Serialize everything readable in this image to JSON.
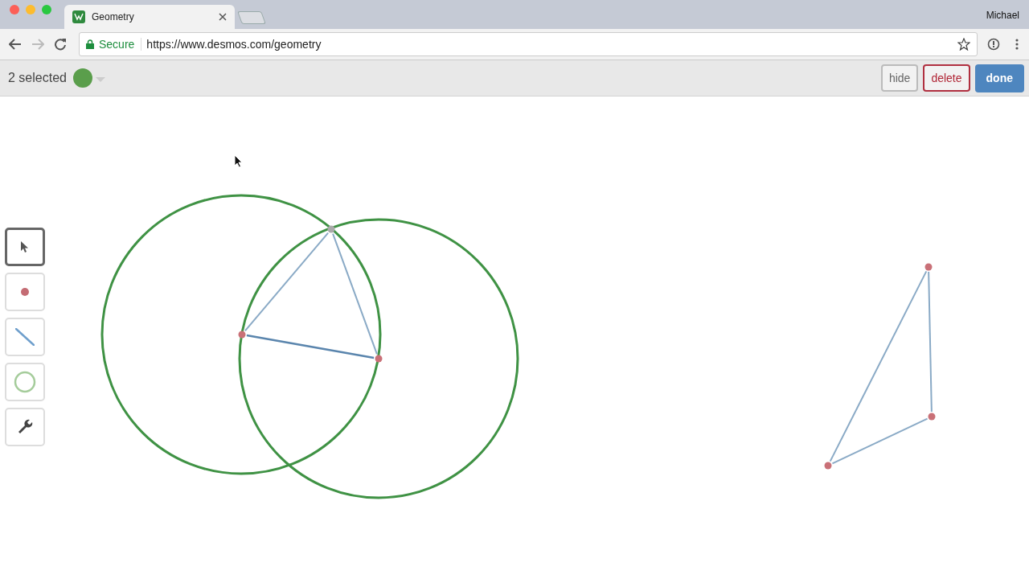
{
  "browser": {
    "tabs": [
      {
        "title": "Geometry",
        "selected": true
      }
    ],
    "profile": "Michael",
    "address": {
      "secure_label": "Secure",
      "url": "https://www.desmos.com/geometry"
    }
  },
  "toolbar": {
    "selection_count": "2 selected",
    "color": "#5a9e4b",
    "buttons": [
      {
        "label": "hide",
        "kind": "plain"
      },
      {
        "label": "delete",
        "kind": "danger"
      },
      {
        "label": "done",
        "kind": "primary"
      }
    ]
  },
  "tools": [
    {
      "kind": "pointer",
      "selected": true
    },
    {
      "kind": "point",
      "selected": false
    },
    {
      "kind": "segment",
      "selected": false
    },
    {
      "kind": "circle",
      "selected": false
    },
    {
      "kind": "wrench",
      "selected": false
    }
  ]
}
